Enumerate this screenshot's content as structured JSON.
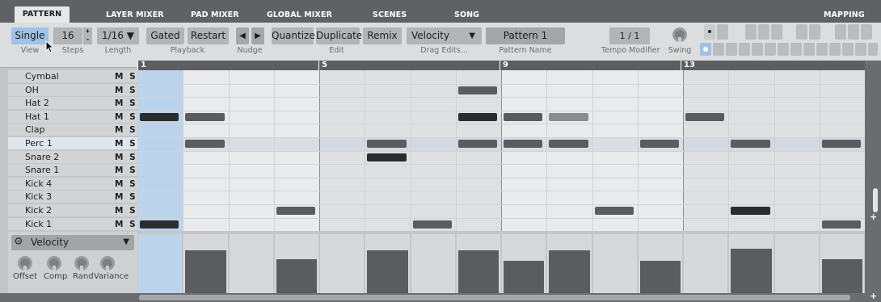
{
  "tabs": [
    {
      "label": "PATTERN",
      "active": true
    },
    {
      "label": "LAYER MIXER",
      "active": false
    },
    {
      "label": "PAD MIXER",
      "active": false
    },
    {
      "label": "GLOBAL MIXER",
      "active": false
    },
    {
      "label": "SCENES",
      "active": false
    },
    {
      "label": "SONG",
      "active": false
    }
  ],
  "mapping_label": "MAPPING",
  "toolbar": {
    "view": {
      "value": "Single",
      "label": "View"
    },
    "steps": {
      "value": "16",
      "label": "Steps",
      "up": "+",
      "down": "-"
    },
    "length": {
      "value": "1/16 ▼",
      "label": "Length"
    },
    "playback": {
      "gated": "Gated",
      "restart": "Restart",
      "label": "Playback"
    },
    "nudge": {
      "left": "◀",
      "right": "▶",
      "label": "Nudge"
    },
    "edit": {
      "quantize": "Quantize",
      "duplicate": "Duplicate",
      "remix": "Remix",
      "label": "Edit"
    },
    "drag_edits": {
      "value": "Velocity",
      "arrow": "▼",
      "label": "Drag Edits..."
    },
    "pattern_name": {
      "value": "Pattern 1",
      "label": "Pattern Name"
    },
    "tempo_modifier": {
      "value": "1 / 1",
      "label": "Tempo Modifier"
    },
    "swing": {
      "label": "Swing"
    }
  },
  "ruler_marks": [
    "1",
    "5",
    "9",
    "13"
  ],
  "tracks": [
    {
      "name": "Cymbal",
      "ms": "M S"
    },
    {
      "name": "OH",
      "ms": "M S"
    },
    {
      "name": "Hat 2",
      "ms": "M S"
    },
    {
      "name": "Hat 1",
      "ms": "M S"
    },
    {
      "name": "Clap",
      "ms": "M S"
    },
    {
      "name": "Perc 1",
      "ms": "M S"
    },
    {
      "name": "Snare 2",
      "ms": "M S"
    },
    {
      "name": "Snare 1",
      "ms": "M S"
    },
    {
      "name": "Kick 4",
      "ms": "M S"
    },
    {
      "name": "Kick 3",
      "ms": "M S"
    },
    {
      "name": "Kick 2",
      "ms": "M S"
    },
    {
      "name": "Kick 1",
      "ms": "M S"
    }
  ],
  "notes": [
    {
      "track": 1,
      "step": 7,
      "shade": "mid"
    },
    {
      "track": 3,
      "step": 0,
      "shade": "dark"
    },
    {
      "track": 3,
      "step": 1,
      "shade": "mid"
    },
    {
      "track": 3,
      "step": 7,
      "shade": "dark"
    },
    {
      "track": 3,
      "step": 8,
      "shade": "mid"
    },
    {
      "track": 3,
      "step": 9,
      "shade": "light"
    },
    {
      "track": 3,
      "step": 12,
      "shade": "mid"
    },
    {
      "track": 5,
      "step": 1,
      "shade": "mid"
    },
    {
      "track": 5,
      "step": 5,
      "shade": "mid"
    },
    {
      "track": 5,
      "step": 7,
      "shade": "mid"
    },
    {
      "track": 5,
      "step": 8,
      "shade": "mid"
    },
    {
      "track": 5,
      "step": 9,
      "shade": "mid"
    },
    {
      "track": 5,
      "step": 11,
      "shade": "mid"
    },
    {
      "track": 5,
      "step": 13,
      "shade": "mid"
    },
    {
      "track": 5,
      "step": 15,
      "shade": "mid"
    },
    {
      "track": 6,
      "step": 5,
      "shade": "dark"
    },
    {
      "track": 10,
      "step": 3,
      "shade": "mid"
    },
    {
      "track": 10,
      "step": 10,
      "shade": "mid"
    },
    {
      "track": 10,
      "step": 13,
      "shade": "dark"
    },
    {
      "track": 11,
      "step": 0,
      "shade": "dark"
    },
    {
      "track": 11,
      "step": 6,
      "shade": "mid"
    },
    {
      "track": 11,
      "step": 15,
      "shade": "mid"
    }
  ],
  "velocities": [
    0,
    0.72,
    0,
    0.57,
    0,
    0.72,
    0,
    0.72,
    0.55,
    0.72,
    0,
    0.55,
    0,
    0.75,
    0,
    0.57
  ],
  "vel_panel": {
    "dropdown": "Velocity",
    "arrow": "▼",
    "knobs": [
      "Offset",
      "Comp",
      "Rand",
      "Variance"
    ]
  },
  "colors": {
    "dark": "#2a2c2e",
    "mid": "#5a5c5f",
    "light": "#8a8c8e",
    "accent": "#9fc2e6"
  }
}
